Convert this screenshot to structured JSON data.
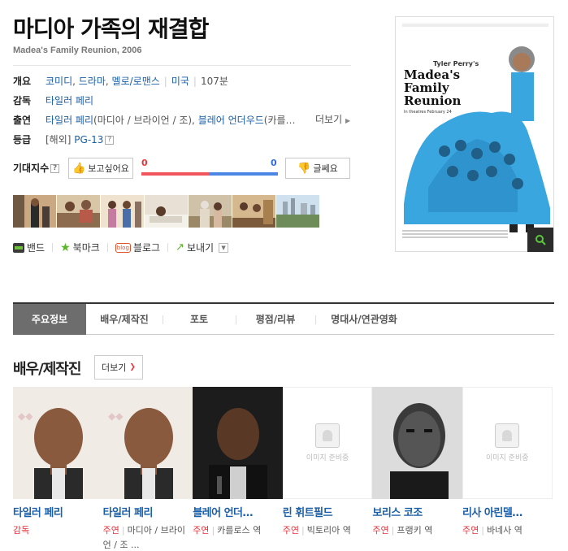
{
  "movie": {
    "title": "마디아 가족의 재결합",
    "subtitle": "Madea's Family Reunion, 2006"
  },
  "info": {
    "genre_label": "개요",
    "genres": [
      "코미디",
      "드라마",
      "멜로/로맨스"
    ],
    "country": "미국",
    "runtime": "107분",
    "director_label": "감독",
    "director": "타일러 페리",
    "cast_label": "출연",
    "cast_main": "타일러 페리",
    "cast_main_role": "(마디아 / 브라이언 / 조)",
    "cast_second": "블레어 언더우드",
    "cast_second_role": "(카를…",
    "more_label": "더보기",
    "rating_label": "등급",
    "rating_region": "[해외]",
    "rating": "PG-13"
  },
  "expect": {
    "label": "기대지수",
    "want_label": "보고싶어요",
    "want_count": "0",
    "nah_label": "글쎄요",
    "nah_count": "0"
  },
  "share": {
    "band": "밴드",
    "bookmark": "북마크",
    "blog": "블로그",
    "blog_icon": "blog",
    "send": "보내기"
  },
  "poster": {
    "presenter": "Tyler Perry's",
    "title_1": "Madea's",
    "title_2": "Family",
    "title_3": "Reunion",
    "tagline": "In theatres February 24"
  },
  "tabs": [
    "주요정보",
    "배우/제작진",
    "포토",
    "평점/리뷰",
    "명대사/연관영화"
  ],
  "cast_section": {
    "title": "배우/제작진",
    "more_label": "더보기",
    "no_image_text": "이미지 준비중",
    "people": [
      {
        "name": "타일러 페리",
        "role": "감독",
        "character": ""
      },
      {
        "name": "타일러 페리",
        "role": "주연",
        "character": "마디아 / 브라이언 / 조 ..."
      },
      {
        "name": "블레어 언더…",
        "role": "주연",
        "character": "카를로스 역"
      },
      {
        "name": "린 휘트필드",
        "role": "주연",
        "character": "빅토리아 역"
      },
      {
        "name": "보리스 코조",
        "role": "주연",
        "character": "프랭키 역"
      },
      {
        "name": "리사 아린델…",
        "role": "주연",
        "character": "바네사 역"
      }
    ]
  },
  "colors": {
    "link": "#1a5fa7",
    "accent_red": "#e8333c",
    "accent_blue": "#2e6ed8",
    "poster_blue": "#3aa6e0"
  }
}
